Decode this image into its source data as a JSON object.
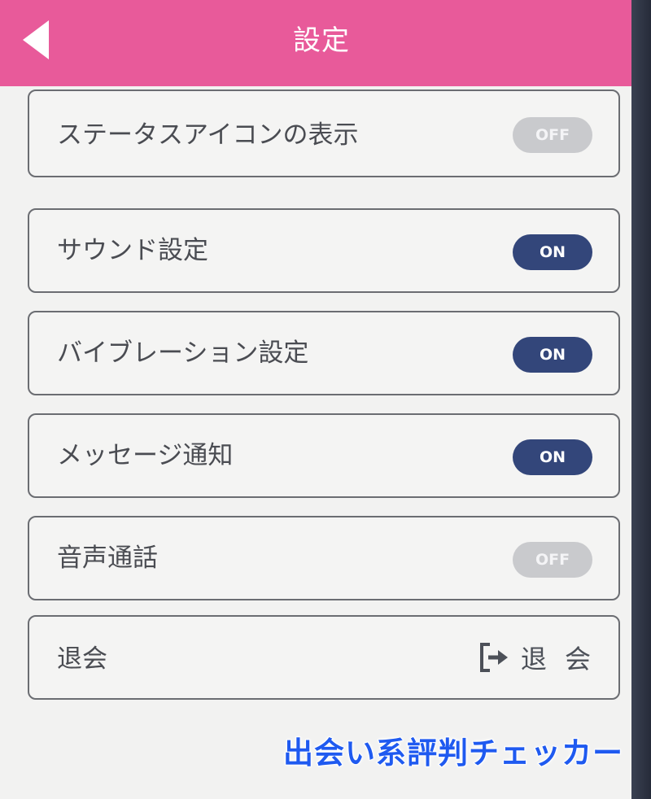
{
  "header": {
    "title": "設定",
    "background_color": "#e85a9a"
  },
  "settings": [
    {
      "label": "ステータスアイコンの表示",
      "toggle": "OFF"
    },
    {
      "label": "サウンド設定",
      "toggle": "ON"
    },
    {
      "label": "バイブレーション設定",
      "toggle": "ON"
    },
    {
      "label": "メッセージ通知",
      "toggle": "ON"
    },
    {
      "label": "音声通話",
      "toggle": "OFF"
    }
  ],
  "withdraw": {
    "label": "退会",
    "action_label": "退 会",
    "icon": "logout-icon"
  },
  "watermark": "出会い系評判チェッカー",
  "colors": {
    "toggle_on": "#33467a",
    "toggle_off": "#c9cacd",
    "watermark": "#1f5af0"
  }
}
